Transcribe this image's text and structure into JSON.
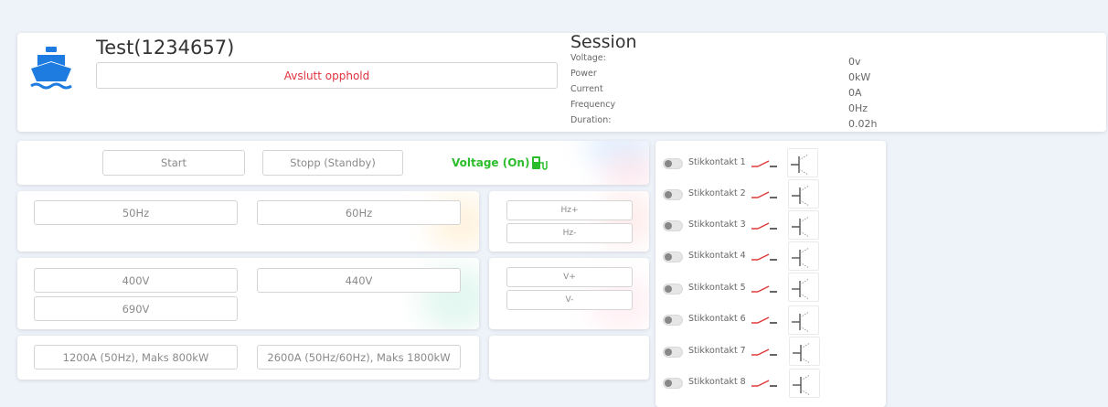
{
  "header": {
    "vessel_name": "Test(1234657)",
    "end_stay_label": "Avslutt opphold",
    "ship_icon": "ship-icon",
    "accent_color": "#1e7ce0"
  },
  "session": {
    "title": "Session",
    "labels": [
      "Voltage:",
      "Power",
      "Current",
      "Frequency",
      "Duration:"
    ],
    "values": [
      "0v",
      "0kW",
      "0A",
      "0Hz",
      "0.02h"
    ]
  },
  "controls": {
    "start_label": "Start",
    "stop_label": "Stopp (Standby)",
    "voltage_status": "Voltage (On)",
    "voltage_status_color": "#2bbd2b",
    "charging_icon": "ev-charger-icon"
  },
  "frequency": {
    "options": [
      "50Hz",
      "60Hz"
    ],
    "up_label": "Hz+",
    "down_label": "Hz-"
  },
  "voltage": {
    "options": [
      "400V",
      "440V",
      "690V"
    ],
    "up_label": "V+",
    "down_label": "V-"
  },
  "current": {
    "options": [
      "1200A (50Hz), Maks 800kW",
      "2600A (50Hz/60Hz), Maks 1800kW"
    ]
  },
  "sockets": [
    {
      "label": "Stikkontakt 1"
    },
    {
      "label": "Stikkontakt 2"
    },
    {
      "label": "Stikkontakt 3"
    },
    {
      "label": "Stikkontakt 4"
    },
    {
      "label": "Stikkontakt 5"
    },
    {
      "label": "Stikkontakt 6"
    },
    {
      "label": "Stikkontakt 7"
    },
    {
      "label": "Stikkontakt 8"
    }
  ],
  "socket_icons": {
    "switch_closed": "switch-closed-icon",
    "switch_open": "switch-open-icon",
    "switch_color": "#e03a3a"
  }
}
